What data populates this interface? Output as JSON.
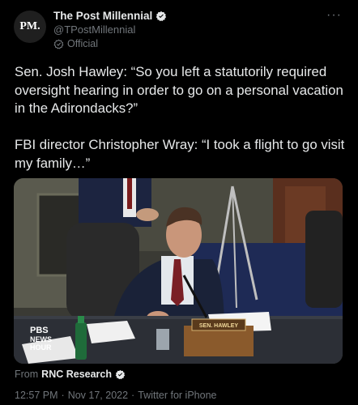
{
  "author": {
    "avatar_text": "PM.",
    "display_name": "The Post Millennial",
    "handle": "@TPostMillennial",
    "label": "Official"
  },
  "more_label": "···",
  "tweet": {
    "text": "Sen. Josh Hawley: “So you left a statutorily required oversight hearing in order to go on a personal vacation in the Adirondacks?”\n\nFBI director Christopher Wray: “I took a flight to go visit my family…”"
  },
  "media": {
    "nameplate": "SEN. HAWLEY",
    "watermark_1": "PBS",
    "watermark_2": "NEWS",
    "watermark_3": "HOUR"
  },
  "attribution": {
    "prefix": "From",
    "source": "RNC Research"
  },
  "meta": {
    "time": "12:57 PM",
    "date": "Nov 17, 2022",
    "client": "Twitter for iPhone",
    "sep": "·"
  },
  "colors": {
    "background": "#000000",
    "text": "#e7e9ea",
    "muted": "#71767b",
    "verified": "#ffffff"
  }
}
